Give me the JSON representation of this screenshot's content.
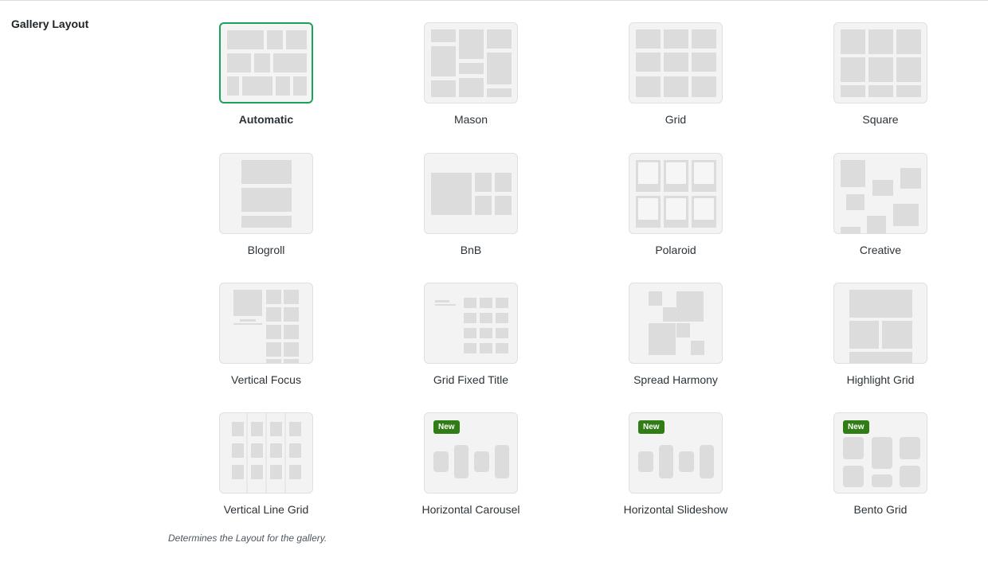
{
  "section": {
    "title": "Gallery Layout",
    "description": "Determines the Layout for the gallery."
  },
  "colors": {
    "selected_border": "#1aa25a",
    "badge_bg": "#2f7d14",
    "block": "#dcdcdc",
    "tile_bg": "#f3f3f3"
  },
  "layouts": [
    {
      "label": "Automatic",
      "icon": "automatic-layout-icon",
      "selected": true
    },
    {
      "label": "Mason",
      "icon": "mason-layout-icon"
    },
    {
      "label": "Grid",
      "icon": "grid-layout-icon"
    },
    {
      "label": "Square",
      "icon": "square-layout-icon"
    },
    {
      "label": "Blogroll",
      "icon": "blogroll-layout-icon"
    },
    {
      "label": "BnB",
      "icon": "bnb-layout-icon"
    },
    {
      "label": "Polaroid",
      "icon": "polaroid-layout-icon"
    },
    {
      "label": "Creative",
      "icon": "creative-layout-icon"
    },
    {
      "label": "Vertical Focus",
      "icon": "vertical-focus-layout-icon"
    },
    {
      "label": "Grid Fixed Title",
      "icon": "grid-fixed-title-layout-icon"
    },
    {
      "label": "Spread Harmony",
      "icon": "spread-harmony-layout-icon"
    },
    {
      "label": "Highlight Grid",
      "icon": "highlight-grid-layout-icon"
    },
    {
      "label": "Vertical Line Grid",
      "icon": "vertical-line-grid-layout-icon"
    },
    {
      "label": "Horizontal Carousel",
      "icon": "horizontal-carousel-layout-icon",
      "badge": "New"
    },
    {
      "label": "Horizontal Slideshow",
      "icon": "horizontal-slideshow-layout-icon",
      "badge": "New"
    },
    {
      "label": "Bento Grid",
      "icon": "bento-grid-layout-icon",
      "badge": "New"
    }
  ]
}
